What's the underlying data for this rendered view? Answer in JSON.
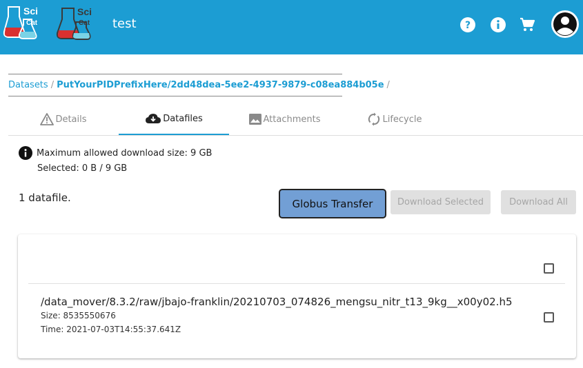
{
  "header": {
    "title": "test",
    "logo_text": "SciCat",
    "accent_color": "#1c9dd3"
  },
  "breadcrumb": {
    "root": "Datasets",
    "separator": "/",
    "pid": "PutYourPIDPrefixHere/2dd48dea-5ee2-4937-9879-c08ea884b05e"
  },
  "tabs": [
    {
      "label": "Details",
      "icon": "warning-icon"
    },
    {
      "label": "Datafiles",
      "icon": "cloud-download-icon"
    },
    {
      "label": "Attachments",
      "icon": "image-icon"
    },
    {
      "label": "Lifecycle",
      "icon": "sync-icon"
    }
  ],
  "active_tab": "Datafiles",
  "download_info": {
    "max_size": "Maximum allowed download size: 9 GB",
    "selected": "Selected: 0 B / 9 GB"
  },
  "file_count": "1 datafile.",
  "buttons": {
    "globus": "Globus Transfer",
    "download_selected": "Download Selected",
    "download_all": "Download All"
  },
  "files": [
    {
      "path": "/data_mover/8.3.2/raw/jbajo-franklin/20210703_074826_mengsu_nitr_t13_9kg__x00y02.h5",
      "size": "Size: 8535550676",
      "time": "Time: 2021-07-03T14:55:37.641Z"
    }
  ]
}
